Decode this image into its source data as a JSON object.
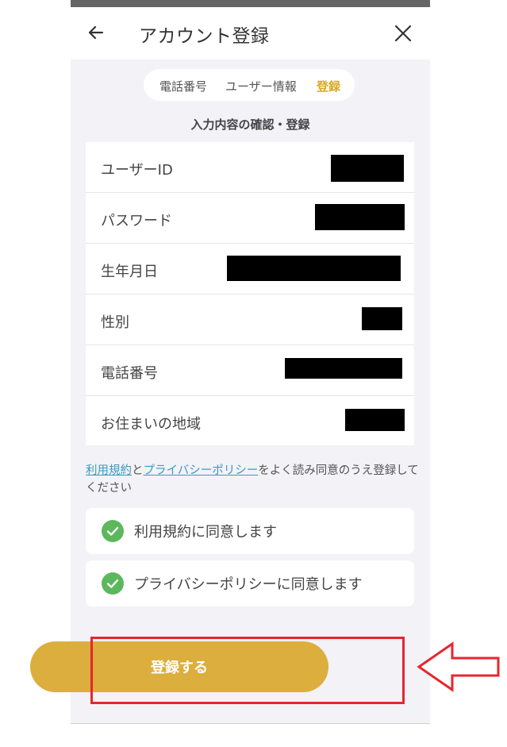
{
  "header": {
    "title": "アカウント登録"
  },
  "steps": {
    "items": [
      {
        "label": "電話番号",
        "active": false
      },
      {
        "label": "ユーザー情報",
        "active": false
      },
      {
        "label": "登録",
        "active": true
      }
    ],
    "active_color": "#d9a827"
  },
  "section_title": "入力内容の確認・登録",
  "fields": [
    {
      "label": "ユーザーID",
      "value_redacted": true
    },
    {
      "label": "パスワード",
      "value_redacted": true
    },
    {
      "label": "生年月日",
      "value_redacted": true
    },
    {
      "label": "性別",
      "value_redacted": true
    },
    {
      "label": "電話番号",
      "value_redacted": true
    },
    {
      "label": "お住まいの地域",
      "value_redacted": true
    }
  ],
  "consent": {
    "terms_link": "利用規約",
    "joiner": "と",
    "privacy_link": "プライバシーポリシー",
    "suffix": "をよく読み同意のうえ登録してください"
  },
  "checkboxes": [
    {
      "label": "利用規約に同意します",
      "checked": true
    },
    {
      "label": "プライバシーポリシーに同意します",
      "checked": true
    }
  ],
  "submit": {
    "label": "登録する",
    "color": "#dcae3d"
  },
  "annotation": {
    "highlight_color": "#e8252f"
  }
}
